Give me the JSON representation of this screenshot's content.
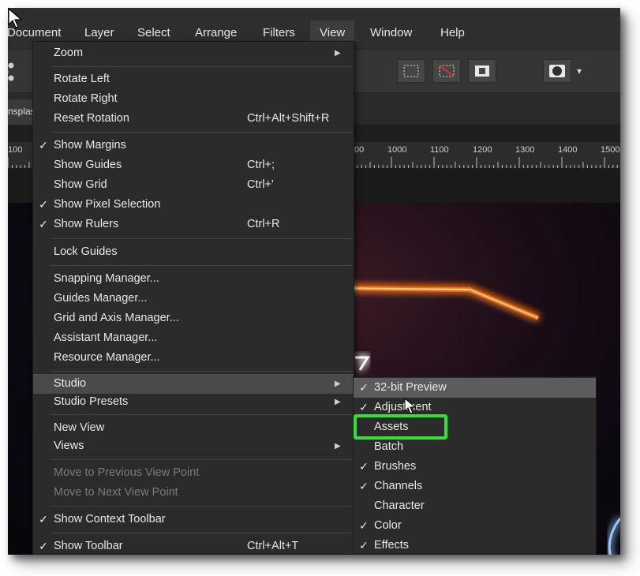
{
  "menubar": {
    "items": [
      "Document",
      "Layer",
      "Select",
      "Arrange",
      "Filters",
      "View",
      "Window",
      "Help"
    ]
  },
  "doc_tab": {
    "label": "nsplas"
  },
  "ruler": {
    "labels": [
      "100",
      "1000",
      "1100",
      "1200",
      "1300",
      "1400",
      "1500"
    ],
    "partial_label": "00"
  },
  "view_menu": {
    "items": [
      {
        "label": "Zoom",
        "checked": false,
        "shortcut": "",
        "submenu": true
      },
      {
        "label": "Rotate Left",
        "checked": false,
        "shortcut": ""
      },
      {
        "label": "Rotate Right",
        "checked": false,
        "shortcut": ""
      },
      {
        "label": "Reset Rotation",
        "checked": false,
        "shortcut": "Ctrl+Alt+Shift+R"
      },
      {
        "label": "Show Margins",
        "checked": true,
        "shortcut": ""
      },
      {
        "label": "Show Guides",
        "checked": false,
        "shortcut": "Ctrl+;"
      },
      {
        "label": "Show Grid",
        "checked": false,
        "shortcut": "Ctrl+'"
      },
      {
        "label": "Show Pixel Selection",
        "checked": true,
        "shortcut": ""
      },
      {
        "label": "Show Rulers",
        "checked": true,
        "shortcut": "Ctrl+R"
      },
      {
        "label": "Lock Guides",
        "checked": false,
        "shortcut": ""
      },
      {
        "label": "Snapping Manager...",
        "checked": false,
        "shortcut": ""
      },
      {
        "label": "Guides Manager...",
        "checked": false,
        "shortcut": ""
      },
      {
        "label": "Grid and Axis Manager...",
        "checked": false,
        "shortcut": ""
      },
      {
        "label": "Assistant Manager...",
        "checked": false,
        "shortcut": ""
      },
      {
        "label": "Resource Manager...",
        "checked": false,
        "shortcut": ""
      },
      {
        "label": "Studio",
        "checked": false,
        "shortcut": "",
        "submenu": true
      },
      {
        "label": "Studio Presets",
        "checked": false,
        "shortcut": "",
        "submenu": true
      },
      {
        "label": "New View",
        "checked": false,
        "shortcut": ""
      },
      {
        "label": "Views",
        "checked": false,
        "shortcut": "",
        "submenu": true
      },
      {
        "label": "Move to Previous View Point",
        "checked": false,
        "shortcut": "",
        "disabled": true
      },
      {
        "label": "Move to Next View Point",
        "checked": false,
        "shortcut": "",
        "disabled": true
      },
      {
        "label": "Show Context Toolbar",
        "checked": true,
        "shortcut": ""
      },
      {
        "label": "Show Toolbar",
        "checked": true,
        "shortcut": "Ctrl+Alt+T"
      }
    ]
  },
  "studio_menu": {
    "items": [
      {
        "label": "32-bit Preview",
        "checked": true
      },
      {
        "label": "Adjustment",
        "checked": true
      },
      {
        "label": "Assets",
        "checked": false
      },
      {
        "label": "Batch",
        "checked": false
      },
      {
        "label": "Brushes",
        "checked": true
      },
      {
        "label": "Channels",
        "checked": true
      },
      {
        "label": "Character",
        "checked": false
      },
      {
        "label": "Color",
        "checked": true
      },
      {
        "label": "Effects",
        "checked": true
      }
    ]
  },
  "glyphs": {
    "check": "✓",
    "submenu_arrow": "▶",
    "dropdown_arrow": "▾"
  },
  "colors": {
    "highlight_box": "#35e035",
    "menu_bg": "#2b2b2b",
    "glow": "#ff8a2a"
  }
}
